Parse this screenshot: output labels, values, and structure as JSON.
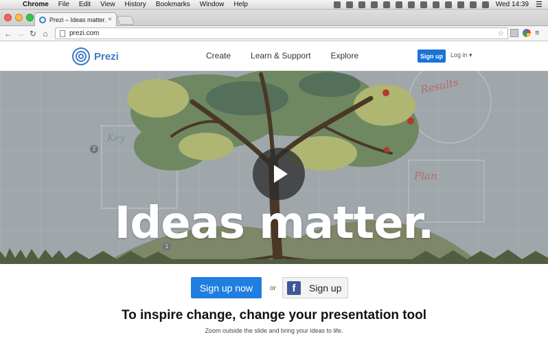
{
  "menubar": {
    "app_name": "Chrome",
    "items": [
      "File",
      "Edit",
      "View",
      "History",
      "Bookmarks",
      "Window",
      "Help"
    ],
    "clock": "Wed 14:39"
  },
  "browser": {
    "tab_title": "Prezi – Ideas matter.",
    "url": "prezi.com"
  },
  "site": {
    "logo_text": "Prezi",
    "nav": [
      "Create",
      "Learn & Support",
      "Explore"
    ],
    "signup_label": "Sign up",
    "login_label": "Log in ▾"
  },
  "hero": {
    "title": "Ideas matter.",
    "sketch_key": "Key",
    "sketch_results": "Results",
    "sketch_plan": "Plan",
    "step_2": "2",
    "step_1": "1"
  },
  "cta": {
    "signup_now_label": "Sign up now",
    "or_text": "or",
    "fb_signup_label": "Sign up"
  },
  "tagline": "To inspire change, change your presentation tool",
  "subline": "Zoom outside the slide and bring your ideas to life.",
  "colors": {
    "brand_blue": "#3a7bc8",
    "cta_blue": "#1f7fe0",
    "facebook": "#3b5998"
  }
}
